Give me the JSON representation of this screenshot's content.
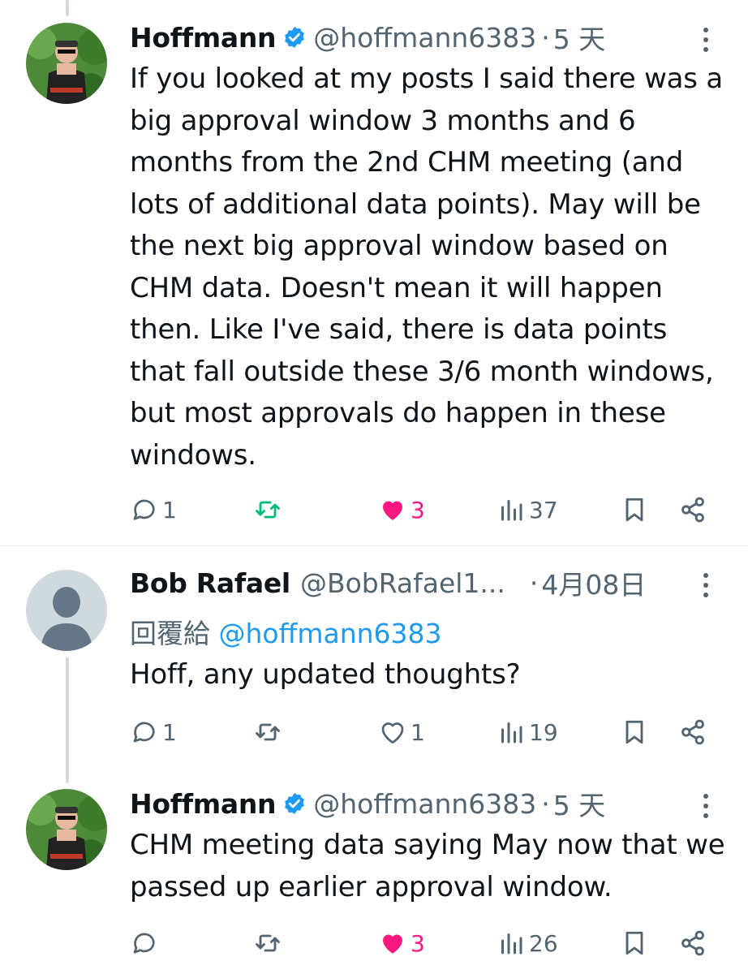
{
  "colors": {
    "accent": "#1d9bf0",
    "like": "#f91880",
    "repost": "#00ba7c",
    "muted": "#536471"
  },
  "tweets": [
    {
      "name": "Hoffmann",
      "verified": true,
      "handle": "@hoffmann6383",
      "sep": "·",
      "time": "5 天",
      "text": "If you looked at my posts I said there was a big approval window 3 months and 6 months from the 2nd CHM meeting (and lots of additional data points). May will be the next big approval window based on CHM data. Doesn't mean it will happen then. Like I've said, there is data points that fall outside these 3/6 month windows, but most approvals do happen in these windows.",
      "actions": {
        "replies": "1",
        "reposts": "",
        "reposted": true,
        "likes": "3",
        "liked": true,
        "views": "37"
      }
    },
    {
      "name": "Bob Rafael",
      "verified": false,
      "handle": "@BobRafael1...",
      "sep": "·",
      "time": "4月08日",
      "reply_prefix": "回覆給",
      "reply_to": "@hoffmann6383",
      "text": "Hoff, any updated thoughts?",
      "actions": {
        "replies": "1",
        "reposts": "",
        "reposted": false,
        "likes": "1",
        "liked": false,
        "views": "19"
      }
    },
    {
      "name": "Hoffmann",
      "verified": true,
      "handle": "@hoffmann6383",
      "sep": "·",
      "time": "5 天",
      "text": "CHM meeting data saying May now that we passed up earlier approval window.",
      "actions": {
        "replies": "",
        "reposts": "",
        "reposted": false,
        "likes": "3",
        "liked": true,
        "views": "26"
      }
    }
  ]
}
